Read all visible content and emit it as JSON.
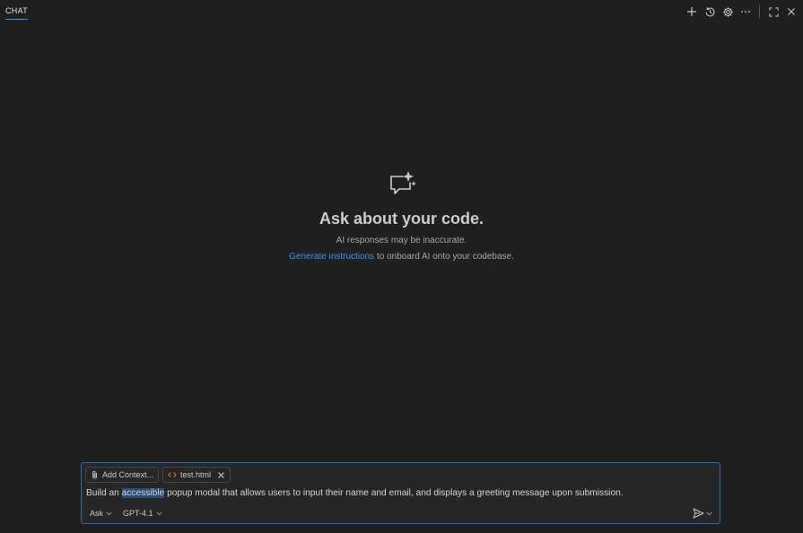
{
  "header": {
    "tab_label": "CHAT",
    "icons": [
      "plus-icon",
      "history-icon",
      "gear-icon",
      "more-icon",
      "maximize-icon",
      "close-icon"
    ]
  },
  "welcome": {
    "title": "Ask about your code.",
    "subtitle": "AI responses may be inaccurate.",
    "generate_link": "Generate instructions",
    "generate_rest": " to onboard AI onto your codebase."
  },
  "input": {
    "add_context_label": "Add Context...",
    "file_chip_label": "test.html",
    "prompt_before": "Build an ",
    "prompt_highlight": "accessible",
    "prompt_after": " popup modal that allows users to input their name and email, and displays a greeting message upon submission.",
    "mode_label": "Ask",
    "model_label": "GPT-4.1"
  },
  "colors": {
    "background": "#1f1f1f",
    "accent": "#3794ff",
    "selection": "#264f78",
    "file_icon": "#e37933"
  }
}
